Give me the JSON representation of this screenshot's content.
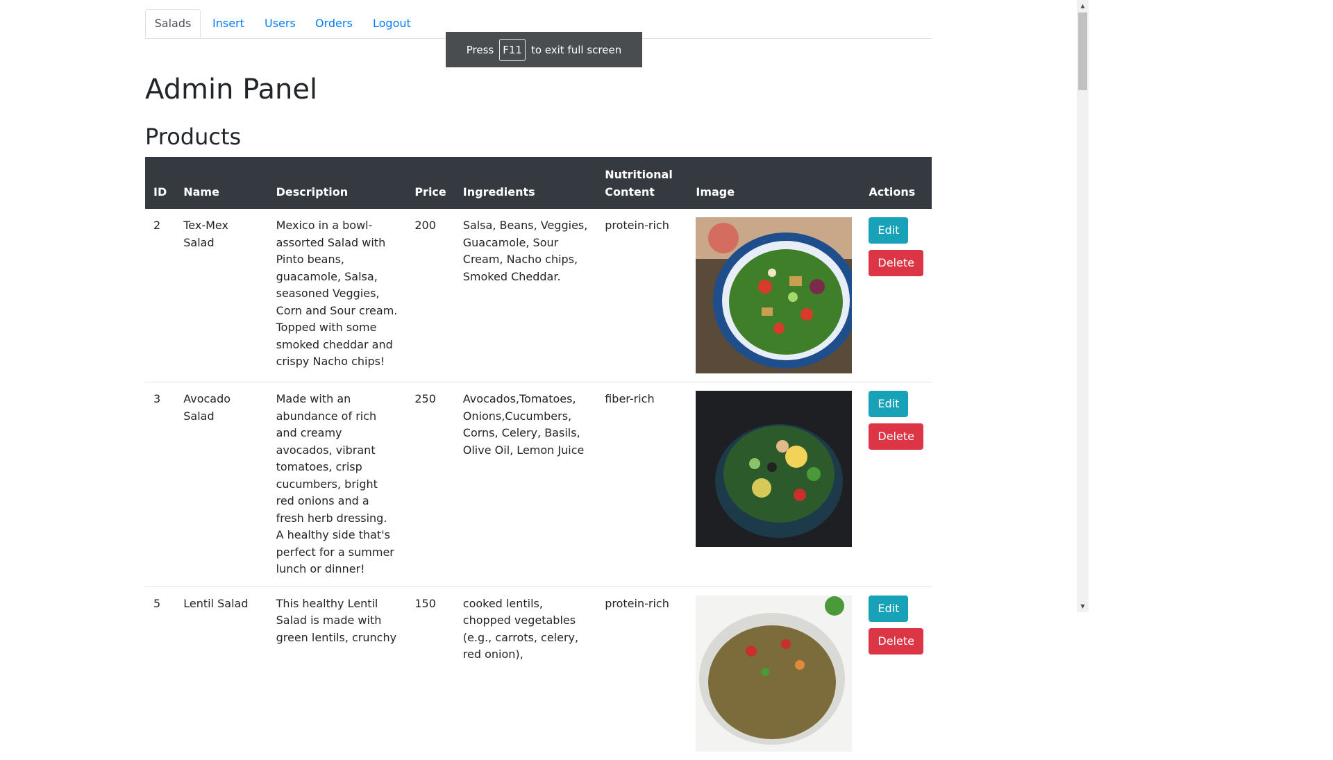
{
  "nav": {
    "tabs": [
      {
        "label": "Salads",
        "active": true
      },
      {
        "label": "Insert",
        "active": false
      },
      {
        "label": "Users",
        "active": false
      },
      {
        "label": "Orders",
        "active": false
      },
      {
        "label": "Logout",
        "active": false
      }
    ]
  },
  "page": {
    "title": "Admin Panel",
    "subtitle": "Products"
  },
  "table": {
    "headers": {
      "id": "ID",
      "name": "Name",
      "description": "Description",
      "price": "Price",
      "ingredients": "Ingredients",
      "nutrition": "Nutritional Content",
      "image": "Image",
      "actions": "Actions"
    },
    "rows": [
      {
        "id": "2",
        "name": "Tex-Mex Salad",
        "description": "Mexico in a bowl-assorted Salad with Pinto beans, guacamole, Salsa, seasoned Veggies, Corn and Sour cream. Topped with some smoked cheddar and crispy Nacho chips!",
        "price": "200",
        "ingredients": "Salsa, Beans, Veggies, Guacamole, Sour Cream, Nacho chips, Smoked Cheddar.",
        "nutrition": "protein-rich",
        "edit_label": "Edit",
        "delete_label": "Delete"
      },
      {
        "id": "3",
        "name": "Avocado Salad",
        "description": "Made with an abundance of rich and creamy avocados, vibrant tomatoes, crisp cucumbers, bright red onions and a fresh herb dressing. A healthy side that's perfect for a summer lunch or dinner!",
        "price": "250",
        "ingredients": "Avocados,Tomatoes, Onions,Cucumbers, Corns, Celery, Basils, Olive Oil, Lemon Juice",
        "nutrition": "fiber-rich",
        "edit_label": "Edit",
        "delete_label": "Delete"
      },
      {
        "id": "5",
        "name": "Lentil Salad",
        "description": "This healthy Lentil Salad is made with green lentils, crunchy",
        "price": "150",
        "ingredients": "cooked lentils, chopped vegetables (e.g., carrots, celery, red onion),",
        "nutrition": "protein-rich",
        "edit_label": "Edit",
        "delete_label": "Delete"
      }
    ]
  },
  "fullscreen_notice": {
    "press": "Press",
    "key": "F11",
    "rest": "to exit full screen"
  },
  "colors": {
    "primary": "#007bff",
    "info": "#17a2b8",
    "danger": "#dc3545",
    "dark": "#343a40"
  }
}
